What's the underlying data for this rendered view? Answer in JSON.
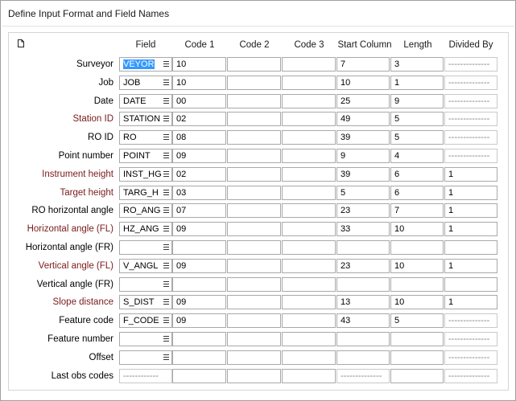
{
  "window": {
    "title": "Define Input Format and Field Names"
  },
  "headers": {
    "field": "Field",
    "code1": "Code 1",
    "code2": "Code 2",
    "code3": "Code 3",
    "start": "Start Column",
    "length": "Length",
    "divided": "Divided By"
  },
  "rows": [
    {
      "label": "Surveyor",
      "field": "VEYOR",
      "code1": "10",
      "code2": "",
      "code3": "",
      "start": "7",
      "length": "3",
      "divided": "--------------"
    },
    {
      "label": "Job",
      "field": "JOB",
      "code1": "10",
      "code2": "",
      "code3": "",
      "start": "10",
      "length": "1",
      "divided": "--------------"
    },
    {
      "label": "Date",
      "field": "DATE",
      "code1": "00",
      "code2": "",
      "code3": "",
      "start": "25",
      "length": "9",
      "divided": "--------------"
    },
    {
      "label": "Station ID",
      "field": "STATION",
      "code1": "02",
      "code2": "",
      "code3": "",
      "start": "49",
      "length": "5",
      "divided": "--------------"
    },
    {
      "label": "RO ID",
      "field": "RO",
      "code1": "08",
      "code2": "",
      "code3": "",
      "start": "39",
      "length": "5",
      "divided": "--------------"
    },
    {
      "label": "Point number",
      "field": "POINT",
      "code1": "09",
      "code2": "",
      "code3": "",
      "start": "9",
      "length": "4",
      "divided": "--------------"
    },
    {
      "label": "Instrument height",
      "field": "INST_HG",
      "code1": "02",
      "code2": "",
      "code3": "",
      "start": "39",
      "length": "6",
      "divided": "1"
    },
    {
      "label": "Target height",
      "field": "TARG_H",
      "code1": "03",
      "code2": "",
      "code3": "",
      "start": "5",
      "length": "6",
      "divided": "1"
    },
    {
      "label": "RO horizontal angle",
      "field": "RO_ANG",
      "code1": "07",
      "code2": "",
      "code3": "",
      "start": "23",
      "length": "7",
      "divided": "1"
    },
    {
      "label": "Horizontal angle (FL)",
      "field": "HZ_ANG",
      "code1": "09",
      "code2": "",
      "code3": "",
      "start": "33",
      "length": "10",
      "divided": "1"
    },
    {
      "label": "Horizontal angle (FR)",
      "field": "",
      "code1": "",
      "code2": "",
      "code3": "",
      "start": "",
      "length": "",
      "divided": ""
    },
    {
      "label": "Vertical angle (FL)",
      "field": "V_ANGL",
      "code1": "09",
      "code2": "",
      "code3": "",
      "start": "23",
      "length": "10",
      "divided": "1"
    },
    {
      "label": "Vertical angle (FR)",
      "field": "",
      "code1": "",
      "code2": "",
      "code3": "",
      "start": "",
      "length": "",
      "divided": ""
    },
    {
      "label": "Slope distance",
      "field": "S_DIST",
      "code1": "09",
      "code2": "",
      "code3": "",
      "start": "13",
      "length": "10",
      "divided": "1"
    },
    {
      "label": "Feature code",
      "field": "F_CODE",
      "code1": "09",
      "code2": "",
      "code3": "",
      "start": "43",
      "length": "5",
      "divided": "--------------"
    },
    {
      "label": "Feature number",
      "field": "",
      "code1": "",
      "code2": "",
      "code3": "",
      "start": "",
      "length": "",
      "divided": "--------------"
    },
    {
      "label": "Offset",
      "field": "",
      "code1": "",
      "code2": "",
      "code3": "",
      "start": "",
      "length": "",
      "divided": "--------------"
    },
    {
      "label": "Last obs codes",
      "field": "------------",
      "code1": "",
      "code2": "",
      "code3": "",
      "start": "--------------",
      "length": "",
      "divided": "--------------"
    }
  ],
  "required_rows": [
    "Station ID",
    "Instrument height",
    "Target height",
    "Horizontal angle (FL)",
    "Vertical angle (FL)",
    "Slope distance"
  ],
  "selected_row": "Surveyor",
  "colors": {
    "required_label": "#7a1a1a",
    "selection": "#3399ff"
  },
  "icons": {
    "new_document": "document-icon",
    "field_menu": "menu-icon"
  }
}
